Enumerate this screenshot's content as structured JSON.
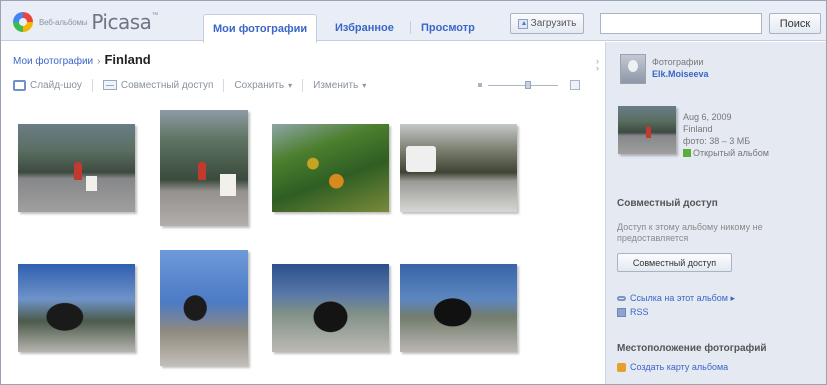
{
  "header": {
    "logo_sub": "Веб-альбомы",
    "logo_main": "Picasa",
    "logo_tm": "™",
    "tabs": [
      {
        "label": "Мои фотографии",
        "active": true
      },
      {
        "label": "Избранное",
        "active": false
      },
      {
        "label": "Просмотр",
        "active": false
      }
    ],
    "upload_label": "Загрузить",
    "search": {
      "value": "",
      "button": "Поиск"
    }
  },
  "breadcrumb": {
    "parent": "Мои фотографии",
    "separator": "›",
    "current": "Finland"
  },
  "toolbar": {
    "slideshow": "Слайд-шоу",
    "share": "Совместный доступ",
    "save": "Сохранить",
    "edit": "Изменить",
    "caret": "▾"
  },
  "photos": [
    {
      "icon": "street-photo"
    },
    {
      "icon": "street-photo"
    },
    {
      "icon": "flowers-photo"
    },
    {
      "icon": "van-photo"
    },
    {
      "icon": "statue-photo"
    },
    {
      "icon": "statue-photo"
    },
    {
      "icon": "statue-photo"
    },
    {
      "icon": "statue-photo"
    }
  ],
  "sidebar": {
    "owner_label": "Фотографии",
    "owner_name": "Elk.Moiseeva",
    "album_date": "Aug 6, 2009",
    "album_location": "Finland",
    "album_count": "фото: 38 – 3 МБ",
    "album_visibility": "Открытый альбом",
    "share_heading": "Совместный доступ",
    "share_note": "Доступ к этому альбому никому не предоставляется",
    "share_button": "Совместный доступ",
    "link_album": "Ссылка на этот альбом ▸",
    "link_rss": "RSS",
    "location_heading": "Местоположение фотографий",
    "create_map": "Создать карту альбома"
  },
  "colors": {
    "accent_link": "#3a66c8",
    "header_bg": "#e9eef6",
    "sidebar_bg": "#e4e9f2",
    "public_green": "#5cad3c"
  }
}
